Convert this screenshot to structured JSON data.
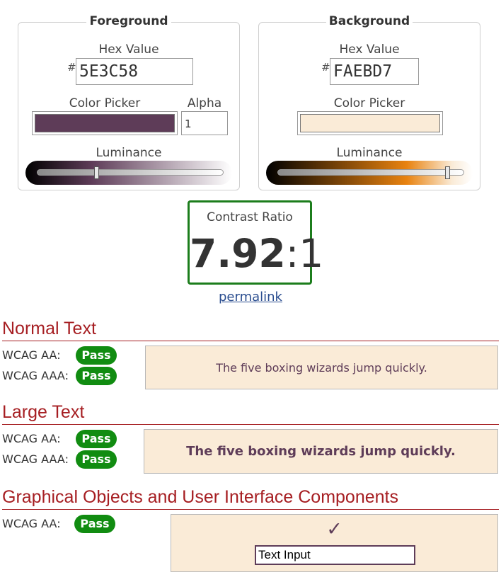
{
  "colors": {
    "foreground": "#5E3C58",
    "background": "#FAEBD7",
    "pass_green": "#118C11",
    "ratio_border": "#1C7D1C",
    "heading_red": "#A61E22",
    "link_blue": "#2A4D8F"
  },
  "foreground": {
    "title": "Foreground",
    "hex_label": "Hex Value",
    "hash": "#",
    "hex_value": "5E3C58",
    "picker_label": "Color Picker",
    "alpha_label": "Alpha",
    "alpha_value": "1",
    "luminance_label": "Luminance",
    "luminance_level": 0.32
  },
  "background": {
    "title": "Background",
    "hex_label": "Hex Value",
    "hash": "#",
    "hex_value": "FAEBD7",
    "picker_label": "Color Picker",
    "luminance_label": "Luminance",
    "luminance_level": 0.91
  },
  "contrast": {
    "title": "Contrast Ratio",
    "value": "7.92",
    "colon": ":",
    "suffix": "1",
    "permalink": "permalink"
  },
  "sections": {
    "normal": {
      "title": "Normal Text",
      "aa_label": "WCAG AA:",
      "aa_result": "Pass",
      "aaa_label": "WCAG AAA:",
      "aaa_result": "Pass",
      "sample": "The five boxing wizards jump quickly."
    },
    "large": {
      "title": "Large Text",
      "aa_label": "WCAG AA:",
      "aa_result": "Pass",
      "aaa_label": "WCAG AAA:",
      "aaa_result": "Pass",
      "sample": "The five boxing wizards jump quickly."
    },
    "graphical": {
      "title": "Graphical Objects and User Interface Components",
      "aa_label": "WCAG AA:",
      "aa_result": "Pass",
      "check_icon": "checkmark-icon",
      "input_sample": "Text Input"
    }
  }
}
